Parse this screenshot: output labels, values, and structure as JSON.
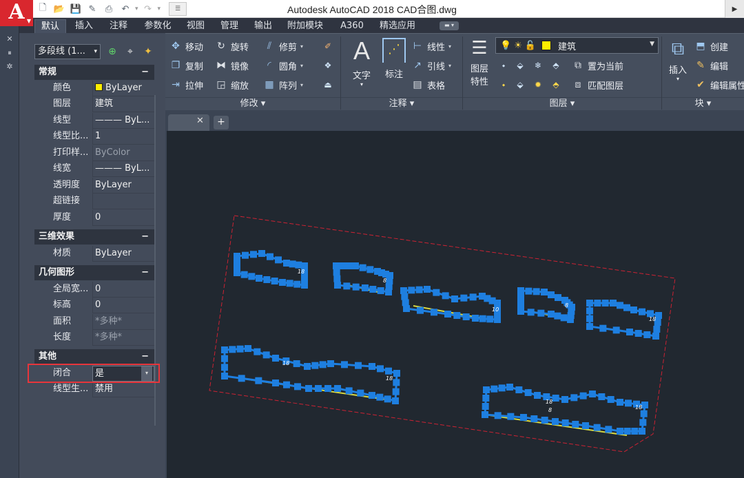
{
  "window_title": "Autodesk AutoCAD 2018    CAD合图.dwg",
  "app_logo": "A",
  "quick_access": [
    "new-icon",
    "open-icon",
    "save-icon",
    "save-as-icon",
    "print-icon",
    "undo-icon",
    "redo-icon"
  ],
  "ribbon_tabs": [
    {
      "label": "默认",
      "active": true
    },
    {
      "label": "插入"
    },
    {
      "label": "注释"
    },
    {
      "label": "参数化"
    },
    {
      "label": "视图"
    },
    {
      "label": "管理"
    },
    {
      "label": "输出"
    },
    {
      "label": "附加模块"
    },
    {
      "label": "A360"
    },
    {
      "label": "精选应用"
    }
  ],
  "ribbon": {
    "modify": {
      "group_label": "修改 ▾",
      "move": "移动",
      "rotate": "旋转",
      "trim": "修剪",
      "copy": "复制",
      "mirror": "镜像",
      "fillet": "圆角",
      "stretch": "拉伸",
      "scale": "缩放",
      "array": "阵列"
    },
    "annotation": {
      "group_label": "注释 ▾",
      "text": "文字",
      "dimension": "标注",
      "linear": "线性",
      "leader": "引线",
      "table": "表格"
    },
    "layers": {
      "group_label": "图层 ▾",
      "layer_properties": [
        "图层",
        "特性"
      ],
      "current_layer": "建筑",
      "layer_color": "#ffee00",
      "make_current": "置为当前",
      "match_layer": "匹配图层"
    },
    "block": {
      "group_label": "块 ▾",
      "insert": "插入",
      "create": "创建",
      "edit": "编辑",
      "edit_attributes": "编辑属性"
    }
  },
  "properties": {
    "object_type": "多段线 (1...",
    "sections": {
      "general": {
        "title": "常规",
        "rows": [
          {
            "key": "颜色",
            "value": "ByLayer",
            "swatch": "#ffee00"
          },
          {
            "key": "图层",
            "value": "建筑"
          },
          {
            "key": "线型",
            "value": "——— ByL..."
          },
          {
            "key": "线型比...",
            "value": "1"
          },
          {
            "key": "打印样...",
            "value": "ByColor",
            "dim": true
          },
          {
            "key": "线宽",
            "value": "——— ByL..."
          },
          {
            "key": "透明度",
            "value": "ByLayer"
          },
          {
            "key": "超链接",
            "value": ""
          },
          {
            "key": "厚度",
            "value": "0"
          }
        ]
      },
      "effects_3d": {
        "title": "三维效果",
        "rows": [
          {
            "key": "材质",
            "value": "ByLayer"
          }
        ]
      },
      "geometry": {
        "title": "几何图形",
        "rows": [
          {
            "key": "全局宽...",
            "value": "0"
          },
          {
            "key": "标高",
            "value": "0"
          },
          {
            "key": "面积",
            "value": "*多种*",
            "dim": true
          },
          {
            "key": "长度",
            "value": "*多种*",
            "dim": true
          }
        ]
      },
      "misc": {
        "title": "其他",
        "rows": [
          {
            "key": "闭合",
            "value": "是"
          },
          {
            "key": "线型生...",
            "value": "禁用"
          }
        ]
      }
    },
    "collapse_symbol": "−"
  },
  "drawing": {
    "boundary_color": "#cc2233",
    "grip_color": "#1e7fe0",
    "line_color": "#d8d840",
    "building_labels": [
      "18",
      "8",
      "10",
      "8",
      "18",
      "18",
      "18",
      "18",
      "8",
      "18"
    ]
  },
  "new_tab_symbol": "+"
}
